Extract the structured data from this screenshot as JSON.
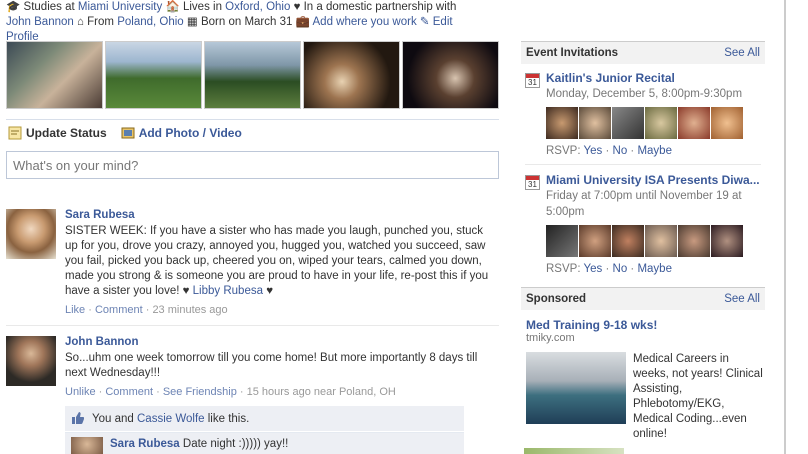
{
  "info": {
    "studies_prefix": "Studies at",
    "studies_link": "Miami University",
    "lives_prefix": "Lives in",
    "lives_link": "Oxford, Ohio",
    "relationship_prefix": "In a domestic partnership with",
    "relationship_link": "John Bannon",
    "from_prefix": "From",
    "from_link": "Poland, Ohio",
    "born": "Born on March 31",
    "add_work": "Add where you work",
    "edit_profile": "Edit Profile"
  },
  "composer": {
    "update_status": "Update Status",
    "add_photo": "Add Photo / Video",
    "placeholder": "What's on your mind?"
  },
  "stories": [
    {
      "actor": "Sara Rubesa",
      "message": "SISTER WEEK: If you have a sister who has made you laugh, punched you, stuck up for you, drove you crazy, annoyed you, hugged you, watched you succeed, saw you fail, picked you back up, cheered you on, wiped your tears, calmed you down, made you strong & is someone you are proud to have in your life, re-post this if you have a sister you love! ♥",
      "mention": "Libby Rubesa",
      "heart": "♥",
      "like": "Like",
      "comment": "Comment",
      "time": "23 minutes ago"
    },
    {
      "actor": "John Bannon",
      "message": "So...uhm one week tomorrow till you come home! But more importantly 8 days till next Wednesday!!!",
      "unlike": "Unlike",
      "comment": "Comment",
      "see_friendship": "See Friendship",
      "time": "15 hours ago near Poland, OH",
      "likes_prefix": "You and",
      "likes_name": "Cassie Wolfe",
      "likes_suffix": "like this.",
      "comment_author": "Sara Rubesa",
      "comment_text": "Date night :))))) yay!!"
    }
  ],
  "sidebar": {
    "events_title": "Event Invitations",
    "see_all": "See All",
    "calendar_day": "31",
    "events": [
      {
        "title": "Kaitlin's Junior Recital",
        "time": "Monday, December 5, 8:00pm-9:30pm",
        "rsvp": "RSVP:",
        "yes": "Yes",
        "no": "No",
        "maybe": "Maybe"
      },
      {
        "title": "Miami University ISA Presents Diwa...",
        "time": "Friday at 7:00pm until November 19 at 5:00pm",
        "rsvp": "RSVP:",
        "yes": "Yes",
        "no": "No",
        "maybe": "Maybe"
      }
    ],
    "sponsored_title": "Sponsored",
    "ad": {
      "title": "Med Training 9-18 wks!",
      "url": "tmiky.com",
      "text": "Medical Careers in weeks, not years! Clinical Assisting, Phlebotomy/EKG, Medical Coding...even online!"
    }
  }
}
